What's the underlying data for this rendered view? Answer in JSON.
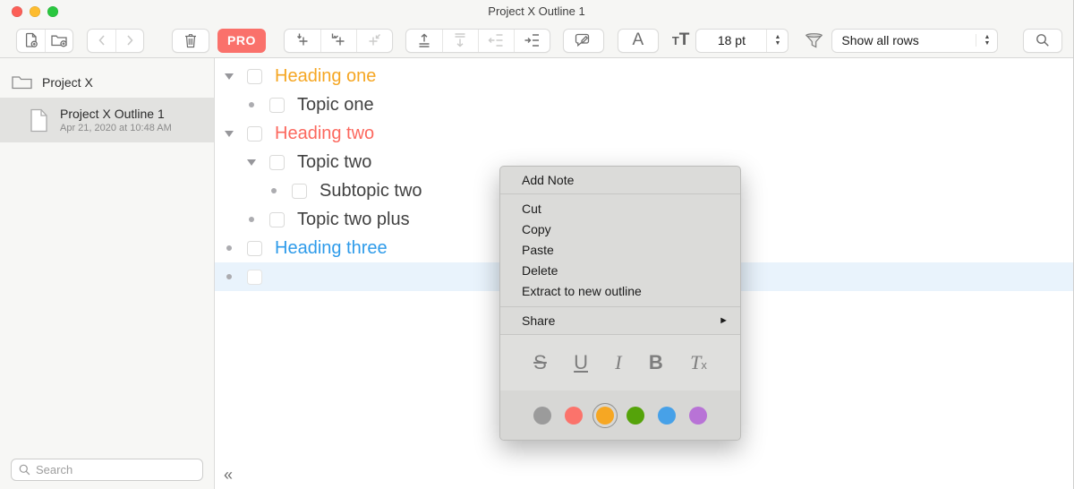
{
  "window": {
    "title": "Project X Outline 1"
  },
  "toolbar": {
    "pro_label": "PRO",
    "font_style_glyph": "A",
    "text_size_small": "T",
    "text_size_large": "T",
    "font_size_value": "18 pt",
    "row_filter_value": "Show all rows",
    "stepper_up": "▲",
    "stepper_down": "▼"
  },
  "sidebar": {
    "folder_label": "Project X",
    "document": {
      "title": "Project X Outline 1",
      "date": "Apr 21, 2020 at 10:48 AM"
    },
    "search_placeholder": "Search"
  },
  "editor": {
    "collapse_glyph": "«",
    "selection_color": "#E9F3FC",
    "rows": [
      {
        "text": "Heading one",
        "level": 0,
        "handle": "triangle",
        "color": "#F5A623",
        "selected": false
      },
      {
        "text": "Topic one",
        "level": 1,
        "handle": "dot",
        "color": "#414141",
        "selected": false
      },
      {
        "text": "Heading two",
        "level": 0,
        "handle": "triangle",
        "color": "#FC685E",
        "selected": false
      },
      {
        "text": "Topic two",
        "level": 1,
        "handle": "triangle",
        "color": "#414141",
        "selected": false
      },
      {
        "text": "Subtopic two",
        "level": 2,
        "handle": "dot",
        "color": "#414141",
        "selected": false
      },
      {
        "text": "Topic two plus",
        "level": 1,
        "handle": "dot",
        "color": "#414141",
        "selected": false
      },
      {
        "text": "Heading three",
        "level": 0,
        "handle": "dot",
        "color": "#2E9BEA",
        "selected": false
      },
      {
        "text": "",
        "level": 0,
        "handle": "dot",
        "color": "#414141",
        "selected": true
      }
    ]
  },
  "context_menu": {
    "add_note": "Add Note",
    "edit_items": [
      "Cut",
      "Copy",
      "Paste",
      "Delete",
      "Extract to new outline"
    ],
    "share_label": "Share",
    "share_arrow": "►",
    "format": {
      "strike": "S",
      "underline": "U",
      "italic": "I",
      "bold": "B",
      "clear_t": "T",
      "clear_x": "x"
    },
    "colors": [
      {
        "name": "gray",
        "hex": "#9B9B9B",
        "selected": false
      },
      {
        "name": "red",
        "hex": "#FB736B",
        "selected": false
      },
      {
        "name": "orange",
        "hex": "#F6A723",
        "selected": true
      },
      {
        "name": "green",
        "hex": "#55A30A",
        "selected": false
      },
      {
        "name": "blue",
        "hex": "#47A1E8",
        "selected": false
      },
      {
        "name": "purple",
        "hex": "#B873D6",
        "selected": false
      }
    ]
  }
}
